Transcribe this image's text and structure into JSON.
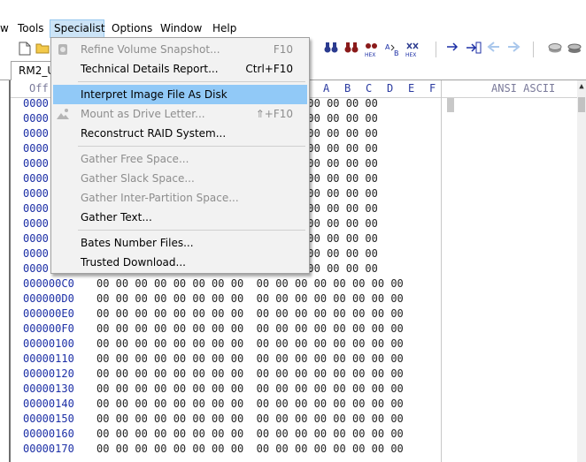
{
  "menubar": {
    "items": [
      {
        "label": "w"
      },
      {
        "label": "Tools"
      },
      {
        "label": "Specialist"
      },
      {
        "label": "Options"
      },
      {
        "label": "Window"
      },
      {
        "label": "Help"
      }
    ]
  },
  "toolbar": {
    "icons": [
      "new-file-icon",
      "open-folder-icon",
      "binoculars-icon",
      "binoculars-red-icon",
      "find-hex-icon",
      "replace-hex-icon",
      "find-hex-alt-icon",
      "goto-arrow-icon",
      "goto-offset-icon",
      "back-arrow-icon",
      "forward-arrow-icon",
      "disk-icon",
      "disk-alt-icon"
    ]
  },
  "tab": {
    "label": "RM2_U"
  },
  "hex": {
    "header_offset": "Off",
    "header_cols": [
      "A",
      "B",
      "C",
      "D",
      "E",
      "F"
    ],
    "header_ascii": "ANSI ASCII",
    "rows": [
      {
        "offset": "0000",
        "bytes": "                        00 00 00 00 00 00 00"
      },
      {
        "offset": "0000",
        "bytes": "                        00 00 00 00 00 00 00"
      },
      {
        "offset": "0000",
        "bytes": "                        00 00 00 00 00 00 00"
      },
      {
        "offset": "0000",
        "bytes": "                        00 00 00 00 00 00 00"
      },
      {
        "offset": "0000",
        "bytes": "                        00 00 00 00 00 00 00"
      },
      {
        "offset": "0000",
        "bytes": "                        00 00 00 00 00 00 00"
      },
      {
        "offset": "0000",
        "bytes": "                        00 00 00 00 00 00 00"
      },
      {
        "offset": "0000",
        "bytes": "                        00 00 00 00 00 00 00"
      },
      {
        "offset": "0000",
        "bytes": "                        00 00 00 00 00 00 00"
      },
      {
        "offset": "0000",
        "bytes": "                        00 00 00 00 00 00 00"
      },
      {
        "offset": "0000",
        "bytes": "                        00 00 00 00 00 00 00"
      },
      {
        "offset": "0000",
        "bytes": "                        00 00 00 00 00 00 00"
      },
      {
        "offset": "000000C0",
        "bytes": "00 00 00 00 00 00 00 00  00 00 00 00 00 00 00 00"
      },
      {
        "offset": "000000D0",
        "bytes": "00 00 00 00 00 00 00 00  00 00 00 00 00 00 00 00"
      },
      {
        "offset": "000000E0",
        "bytes": "00 00 00 00 00 00 00 00  00 00 00 00 00 00 00 00"
      },
      {
        "offset": "000000F0",
        "bytes": "00 00 00 00 00 00 00 00  00 00 00 00 00 00 00 00"
      },
      {
        "offset": "00000100",
        "bytes": "00 00 00 00 00 00 00 00  00 00 00 00 00 00 00 00"
      },
      {
        "offset": "00000110",
        "bytes": "00 00 00 00 00 00 00 00  00 00 00 00 00 00 00 00"
      },
      {
        "offset": "00000120",
        "bytes": "00 00 00 00 00 00 00 00  00 00 00 00 00 00 00 00"
      },
      {
        "offset": "00000130",
        "bytes": "00 00 00 00 00 00 00 00  00 00 00 00 00 00 00 00"
      },
      {
        "offset": "00000140",
        "bytes": "00 00 00 00 00 00 00 00  00 00 00 00 00 00 00 00"
      },
      {
        "offset": "00000150",
        "bytes": "00 00 00 00 00 00 00 00  00 00 00 00 00 00 00 00"
      },
      {
        "offset": "00000160",
        "bytes": "00 00 00 00 00 00 00 00  00 00 00 00 00 00 00 00"
      },
      {
        "offset": "00000170",
        "bytes": "00 00 00 00 00 00 00 00  00 00 00 00 00 00 00 00"
      }
    ]
  },
  "specialist_menu": {
    "items": [
      {
        "label": "Refine Volume Snapshot...",
        "shortcut": "F10",
        "disabled": true,
        "icon": "snapshot-icon"
      },
      {
        "label": "Technical Details Report...",
        "shortcut": "Ctrl+F10",
        "disabled": false
      },
      {
        "label": "Interpret Image File As Disk",
        "shortcut": "",
        "disabled": false,
        "highlighted": true
      },
      {
        "label": "Mount as Drive Letter...",
        "shortcut": "⇑+F10",
        "disabled": true,
        "icon": "mount-icon"
      },
      {
        "label": "Reconstruct RAID System...",
        "shortcut": "",
        "disabled": false
      },
      {
        "label": "Gather Free Space...",
        "shortcut": "",
        "disabled": true
      },
      {
        "label": "Gather Slack Space...",
        "shortcut": "",
        "disabled": true
      },
      {
        "label": "Gather Inter-Partition Space...",
        "shortcut": "",
        "disabled": true
      },
      {
        "label": "Gather Text...",
        "shortcut": "",
        "disabled": false
      },
      {
        "label": "Bates Number Files...",
        "shortcut": "",
        "disabled": false
      },
      {
        "label": "Trusted Download...",
        "shortcut": "",
        "disabled": false
      }
    ]
  },
  "colors": {
    "highlight": "#91c9f7",
    "offset_text": "#1c2fa6",
    "menu_bg": "#f2f2f2",
    "active_menu": "#cce4f7"
  }
}
